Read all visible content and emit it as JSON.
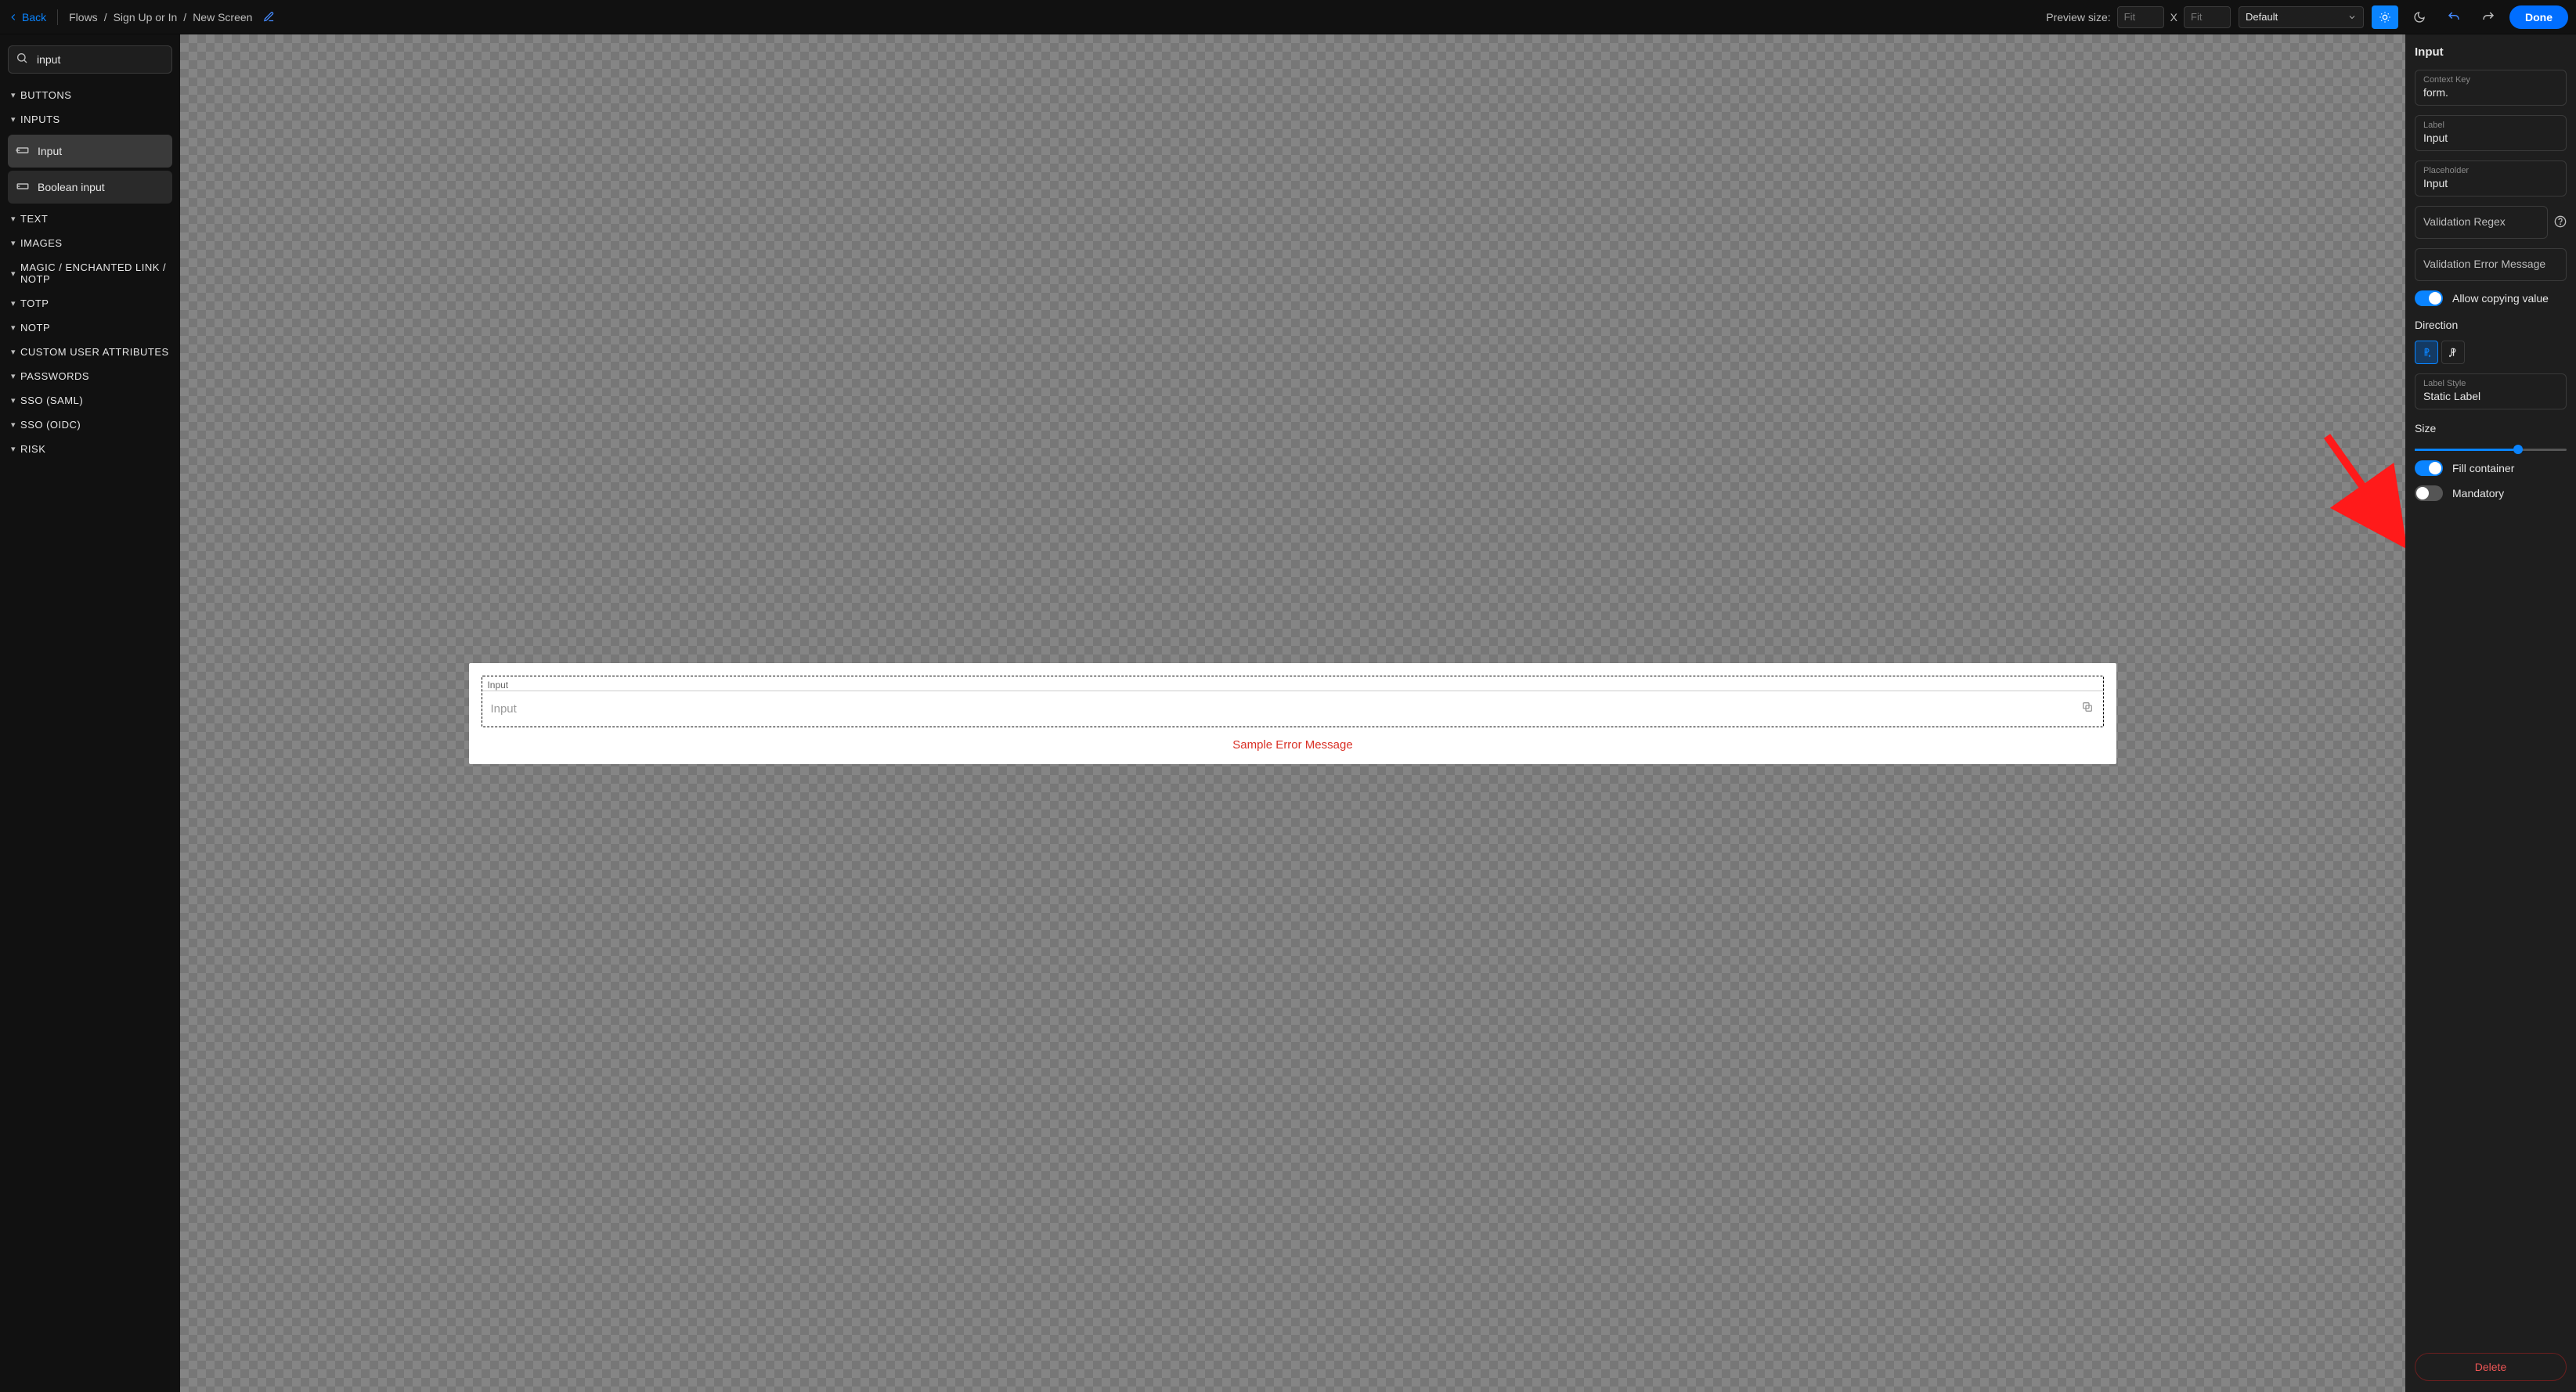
{
  "topbar": {
    "back": "Back",
    "crumbs": [
      "Flows",
      "Sign Up or In",
      "New Screen"
    ],
    "preview_label": "Preview size:",
    "preview_w": "Fit",
    "preview_sep": "X",
    "preview_h": "Fit",
    "theme_selector": "Default",
    "done": "Done"
  },
  "leftbar": {
    "search_value": "input",
    "categories": [
      "BUTTONS",
      "INPUTS",
      "TEXT",
      "IMAGES",
      "MAGIC / ENCHANTED LINK / NOTP",
      "TOTP",
      "NOTP",
      "CUSTOM USER ATTRIBUTES",
      "PASSWORDS",
      "SSO (SAML)",
      "SSO (OIDC)",
      "RISK"
    ],
    "input_items": {
      "input": "Input",
      "boolean_input": "Boolean input"
    }
  },
  "canvas": {
    "field_label": "Input",
    "field_placeholder": "Input",
    "error_message": "Sample Error Message"
  },
  "inspector": {
    "title": "Input",
    "context_key_label": "Context Key",
    "context_key_value": "form.",
    "label_label": "Label",
    "label_value": "Input",
    "placeholder_label": "Placeholder",
    "placeholder_value": "Input",
    "validation_regex_ph": "Validation Regex",
    "validation_err_ph": "Validation Error Message",
    "allow_copy_label": "Allow copying value",
    "direction_header": "Direction",
    "label_style_label": "Label Style",
    "label_style_value": "Static Label",
    "size_header": "Size",
    "fill_container_label": "Fill container",
    "mandatory_label": "Mandatory",
    "delete": "Delete"
  },
  "icons": {
    "search": "search-icon",
    "help": "help-icon",
    "copy": "copy-icon",
    "sun": "sun-icon",
    "moon": "moon-icon",
    "undo": "undo-icon",
    "redo": "redo-icon",
    "edit": "edit-icon",
    "ltr": "ltr-icon",
    "rtl": "rtl-icon",
    "input_box": "input-box-icon"
  }
}
